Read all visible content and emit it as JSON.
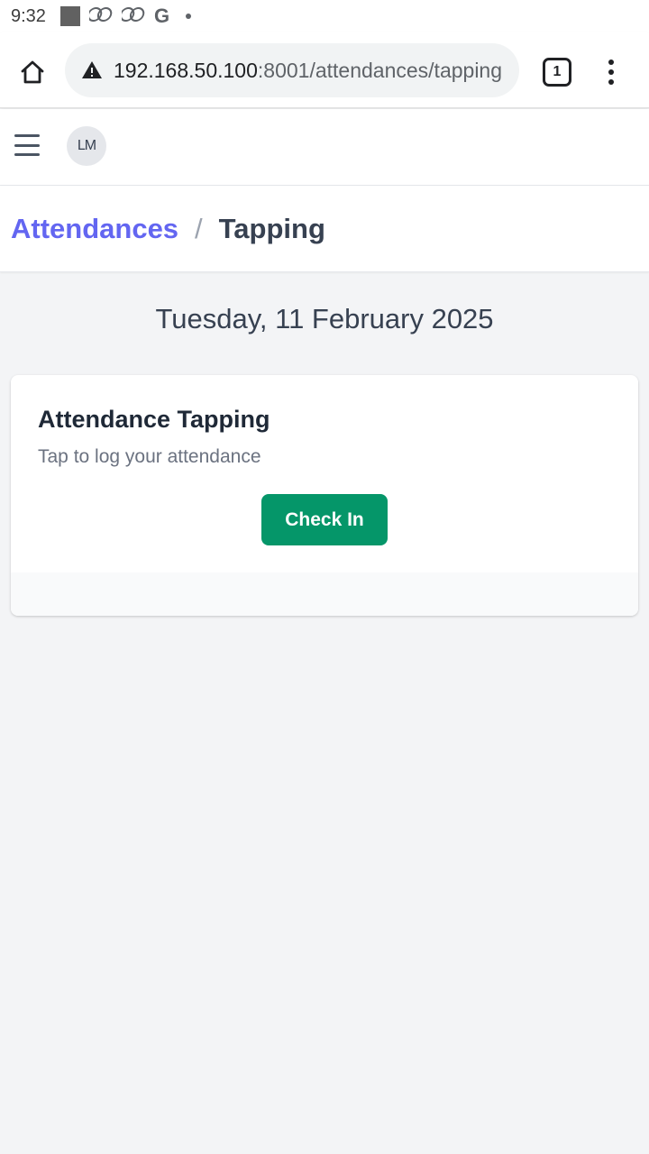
{
  "status_bar": {
    "time": "9:32",
    "icons": [
      "gallery-icon",
      "link-icon",
      "link-icon",
      "google-icon",
      "dot-icon"
    ],
    "google_glyph": "G"
  },
  "browser": {
    "url_host": "192.168.50.100",
    "url_path": ":8001/attendances/tapping",
    "tab_count": "1",
    "security": "not-secure-warning-icon"
  },
  "app_header": {
    "logo_text": "LM"
  },
  "breadcrumb": {
    "parent": "Attendances",
    "separator": "/",
    "current": "Tapping"
  },
  "main": {
    "date": "Tuesday, 11 February 2025",
    "card": {
      "title": "Attendance Tapping",
      "subtitle": "Tap to log your attendance",
      "button_label": "Check In"
    }
  },
  "colors": {
    "accent": "#6366f1",
    "primary_button": "#059669",
    "background": "#f3f4f6"
  }
}
